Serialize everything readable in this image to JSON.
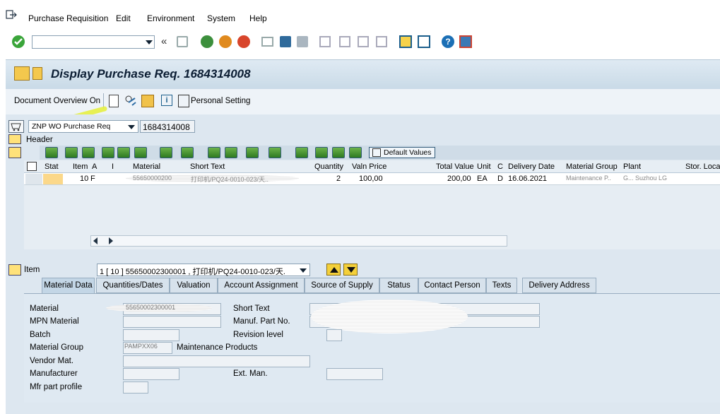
{
  "menu": {
    "items": [
      "Purchase Requisition",
      "Edit",
      "Environment",
      "System",
      "Help"
    ]
  },
  "title": "Display Purchase Req. 1684314008",
  "app_toolbar": {
    "document_overview": "Document Overview On",
    "personal_setting": "Personal Setting"
  },
  "doc_type": "ZNP WO Purchase Req",
  "doc_number": "1684314008",
  "header_label": "Header",
  "item_toolbar": {
    "default_values": "Default Values"
  },
  "table": {
    "columns": [
      "Stat",
      "Item",
      "A",
      "I",
      "Material",
      "Short Text",
      "Quantity",
      "Valn Price",
      "Total Value",
      "Unit",
      "C",
      "Delivery Date",
      "Material Group",
      "Plant",
      "Stor. Loca"
    ],
    "rows": [
      {
        "item": "10",
        "a": "F",
        "material": "55650000200",
        "short_text": "打印机/PQ24-0010-023/天..",
        "quantity": "2",
        "valn_price": "100,00",
        "total_value": "200,00",
        "unit": "EA",
        "c": "D",
        "delivery_date": "16.06.2021",
        "material_group": "Maintenance P..",
        "plant": "G... Suzhou LG"
      }
    ]
  },
  "item_section": {
    "label": "Item",
    "selected_item": "1 [ 10 ] 55650002300001 , 打印机/PQ24-0010-023/天."
  },
  "tabs": [
    "Material Data",
    "Quantities/Dates",
    "Valuation",
    "Account Assignment",
    "Source of Supply",
    "Status",
    "Contact Person",
    "Texts",
    "Delivery Address"
  ],
  "form": {
    "material_label": "Material",
    "material_value": "55650002300001",
    "mpn_label": "MPN Material",
    "batch_label": "Batch",
    "material_group_label": "Material Group",
    "material_group_value": "PAMPXX06",
    "material_group_desc": "Maintenance Products",
    "vendor_mat_label": "Vendor Mat.",
    "manufacturer_label": "Manufacturer",
    "mfr_part_profile_label": "Mfr part profile",
    "short_text_label": "Short Text",
    "manuf_part_label": "Manuf. Part No.",
    "revision_label": "Revision level",
    "ext_man_label": "Ext. Man."
  },
  "colors": {
    "accent": "#1b5e8c",
    "highlight": "#e8f25a",
    "title_bg": "#cfdde9"
  }
}
